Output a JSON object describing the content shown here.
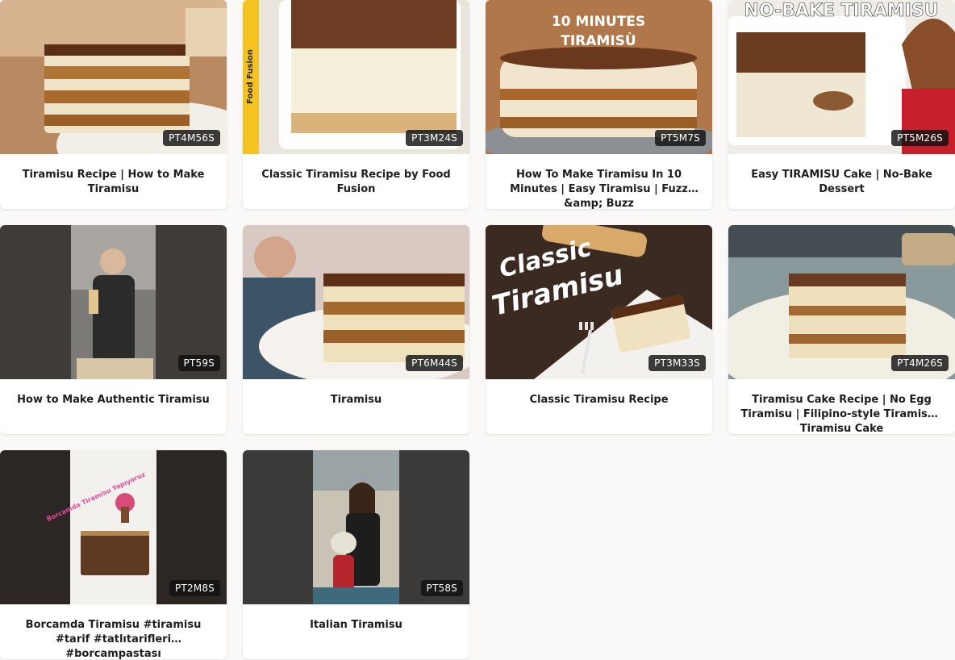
{
  "videos": [
    {
      "title": "Tiramisu Recipe | How to Make Tiramisu",
      "duration": "PT4M56S",
      "thumbnail": "tiramisu-slice-plate"
    },
    {
      "title": "Classic Tiramisu Recipe by Food Fusion",
      "duration": "PT3M24S",
      "thumbnail": "tiramisu-block-food-fusion",
      "thumb_text": "Food Fusion"
    },
    {
      "title": "How To Make Tiramisu In 10 Minutes | Easy Tiramisu | Fuzz &amp; Buzz",
      "duration": "PT5M7S",
      "thumbnail": "round-tiramisu-cake",
      "thumb_text": [
        "10 MINUTES",
        "TIRAMISÙ"
      ]
    },
    {
      "title": "Easy TIRAMISU Cake | No-Bake Dessert",
      "duration": "PT5M26S",
      "thumbnail": "no-bake-tiramisu-dish",
      "thumb_text": "NO-BAKE TIRAMISU"
    },
    {
      "title": "How to Make Authentic Tiramisu",
      "duration": "PT59S",
      "thumbnail": "man-holding-ladyfinger"
    },
    {
      "title": "Tiramisu",
      "duration": "PT6M44S",
      "thumbnail": "chef-with-tiramisu-slice"
    },
    {
      "title": "Classic Tiramisu Recipe",
      "duration": "PT3M33S",
      "thumbnail": "classic-tiramisu-plate-fork",
      "thumb_text": [
        "Classic",
        "Tiramisu"
      ]
    },
    {
      "title": "Tiramisu Cake Recipe | No Egg Tiramisu | Filipino-style Tiramisu | Tiramisu Cake",
      "duration": "PT4M26S",
      "thumbnail": "tiramisu-square-floral-plate"
    },
    {
      "title": "Borcamda Tiramisu #tiramisu #tarif #tatlıtarifleri #borcampastası",
      "duration": "PT2M8S",
      "thumbnail": "tiramisu-tray-vertical",
      "thumb_text": "Borcamda Tiramisu Yapıyoruz"
    },
    {
      "title": "Italian Tiramisu",
      "duration": "PT58S",
      "thumbnail": "woman-mixing-bowl-vertical"
    }
  ],
  "colors": {
    "page_background": "#faf9f7",
    "card_background": "#ffffff",
    "title_text": "#1e1e1e",
    "badge_background": "#111111",
    "badge_text": "#ffffff"
  }
}
